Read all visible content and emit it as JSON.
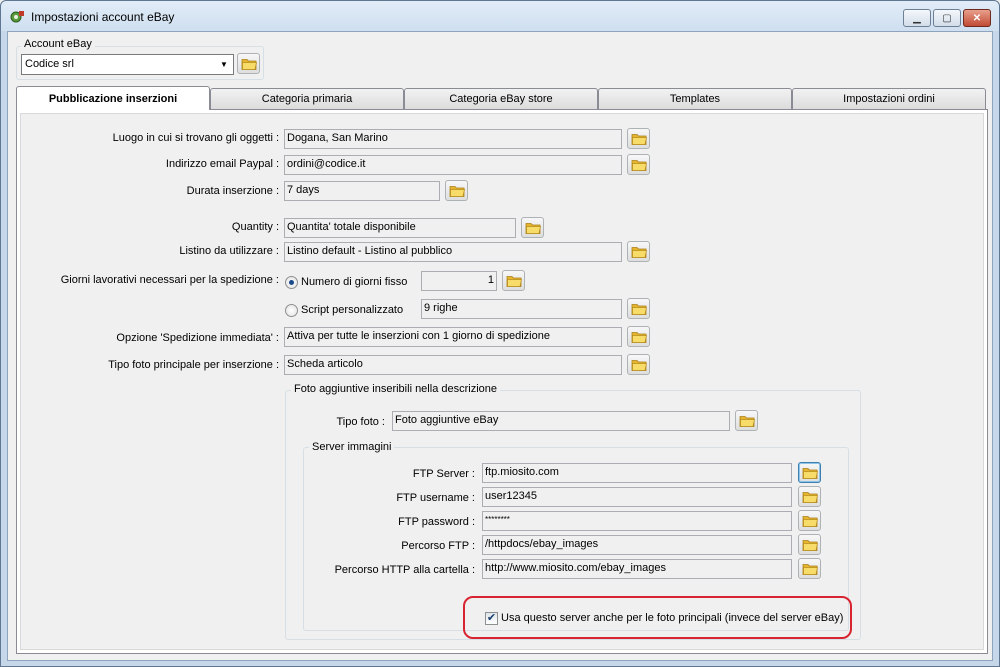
{
  "window": {
    "title": "Impostazioni account eBay",
    "minimize": "▁",
    "maximize": "▢",
    "close": "✕"
  },
  "account": {
    "group_label": "Account eBay",
    "selected": "Codice srl"
  },
  "tabs": [
    {
      "label": "Pubblicazione inserzioni",
      "active": true
    },
    {
      "label": "Categoria primaria",
      "active": false
    },
    {
      "label": "Categoria eBay store",
      "active": false
    },
    {
      "label": "Templates",
      "active": false
    },
    {
      "label": "Impostazioni ordini",
      "active": false
    }
  ],
  "form": {
    "luogo": {
      "label": "Luogo in cui si trovano gli oggetti :",
      "value": "Dogana, San Marino"
    },
    "paypal": {
      "label": "Indirizzo email Paypal :",
      "value": "ordini@codice.it"
    },
    "durata": {
      "label": "Durata inserzione :",
      "value": "7 days"
    },
    "quantity": {
      "label": "Quantity :",
      "value": "Quantita' totale disponibile"
    },
    "listino": {
      "label": "Listino da utilizzare :",
      "value": "Listino default - Listino al pubblico"
    },
    "giorni": {
      "label": "Giorni lavorativi necessari per la spedizione :",
      "option_fisso": "Numero di giorni fisso",
      "fisso_value": "1",
      "option_script": "Script personalizzato",
      "script_value": "9 righe",
      "selected": "fisso"
    },
    "spedizione": {
      "label": "Opzione 'Spedizione immediata' :",
      "value": "Attiva per tutte le inserzioni con 1 giorno di spedizione"
    },
    "foto_principale": {
      "label": "Tipo foto principale per inserzione :",
      "value": "Scheda articolo"
    }
  },
  "foto_aggiuntive": {
    "group_label": "Foto aggiuntive inseribili nella descrizione",
    "tipo_label": "Tipo foto :",
    "tipo_value": "Foto aggiuntive eBay"
  },
  "server": {
    "group_label": "Server immagini",
    "ftp_server": {
      "label": "FTP Server :",
      "value": "ftp.miosito.com"
    },
    "ftp_username": {
      "label": "FTP username :",
      "value": "user12345"
    },
    "ftp_password": {
      "label": "FTP password :",
      "value": "********"
    },
    "percorso_ftp": {
      "label": "Percorso FTP :",
      "value": "/httpdocs/ebay_images"
    },
    "percorso_http": {
      "label": "Percorso HTTP alla cartella :",
      "value": "http://www.miosito.com/ebay_images"
    },
    "use_checkbox": {
      "label": "Usa questo server anche per le foto principali (invece del server eBay)",
      "checked": true
    }
  },
  "colors": {
    "highlight": "#d82430",
    "folder_yellow": "#f2cf4a",
    "folder_dark": "#c99a1a"
  },
  "icons": {
    "app": "gear-app-icon",
    "folder": "folder-icon",
    "dropdown": "chevron-down-icon"
  }
}
